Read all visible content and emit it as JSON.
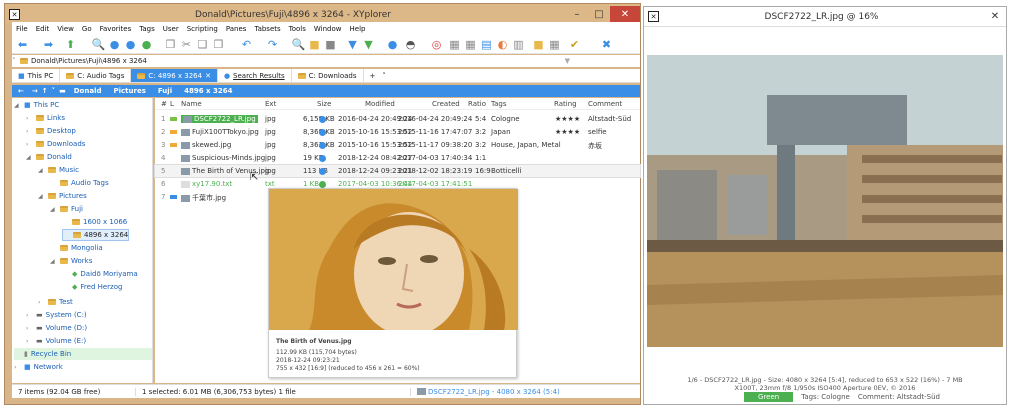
{
  "main": {
    "title": "Donald\\Pictures\\Fuji\\4896 x 3264 - XYplorer",
    "menu": [
      "File",
      "Edit",
      "View",
      "Go",
      "Favorites",
      "Tags",
      "User",
      "Scripting",
      "Panes",
      "Tabsets",
      "Tools",
      "Window",
      "Help"
    ],
    "address": "Donald\\Pictures\\Fuji\\4896 x 3264",
    "tabs": [
      {
        "label": "This PC"
      },
      {
        "label": "C: Audio Tags"
      },
      {
        "label": "C: 4896 x 3264"
      },
      {
        "label": "Search Results"
      },
      {
        "label": "C: Downloads"
      }
    ],
    "tab_add": "+",
    "breadcrumb": [
      "Donald",
      "Pictures",
      "Fuji",
      "4896 x 3264"
    ]
  },
  "tree": [
    {
      "label": "This PC",
      "level": 0
    },
    {
      "label": "Links",
      "level": 1
    },
    {
      "label": "Desktop",
      "level": 1
    },
    {
      "label": "Downloads",
      "level": 1
    },
    {
      "label": "Donald",
      "level": 1
    },
    {
      "label": "Music",
      "level": 2
    },
    {
      "label": "Audio Tags",
      "level": 3
    },
    {
      "label": "Pictures",
      "level": 2
    },
    {
      "label": "Fuji",
      "level": 3
    },
    {
      "label": "1600 x 1066",
      "level": 4
    },
    {
      "label": "4896 x 3264",
      "level": 4
    },
    {
      "label": "Mongolia",
      "level": 3
    },
    {
      "label": "Works",
      "level": 3
    },
    {
      "label": "Daidō Moriyama",
      "level": 4
    },
    {
      "label": "Fred Herzog",
      "level": 4
    },
    {
      "label": "Test",
      "level": 2
    },
    {
      "label": "System (C:)",
      "level": 1
    },
    {
      "label": "Volume (D:)",
      "level": 1
    },
    {
      "label": "Volume (E:)",
      "level": 1
    },
    {
      "label": "Recycle Bin",
      "level": 1
    },
    {
      "label": "Network",
      "level": 0
    }
  ],
  "columns": {
    "num": "#",
    "label": "L",
    "name": "Name",
    "ext": "Ext",
    "size": "Size",
    "modified": "Modified",
    "created": "Created",
    "ratio": "Ratio",
    "tags": "Tags",
    "rating": "Rating",
    "comment": "Comment"
  },
  "rows": [
    {
      "num": "1",
      "name": "DSCF2722_LR.jpg",
      "ext": "jpg",
      "size": "6,159 KB",
      "modified": "2016-04-24 20:49:24",
      "created": "2016-04-24 20:49:24",
      "ratio": "5:4",
      "tags": "Cologne",
      "rating": "★★★★",
      "comment": "Altstadt-Süd"
    },
    {
      "num": "2",
      "name": "FujiX100TTokyo.jpg",
      "ext": "jpg",
      "size": "8,369 KB",
      "modified": "2015-10-16 15:53:52",
      "created": "2015-11-16 17:47:07",
      "ratio": "3:2",
      "tags": "Japan",
      "rating": "★★★★",
      "comment": "selfie"
    },
    {
      "num": "3",
      "name": "skewed.jpg",
      "ext": "jpg",
      "size": "8,363 KB",
      "modified": "2015-10-16 15:53:52",
      "created": "2015-11-17 09:38:20",
      "ratio": "3:2",
      "tags": "House, Japan, Metal",
      "rating": "",
      "comment": "赤坂"
    },
    {
      "num": "4",
      "name": "Suspicious-Minds.jpg",
      "ext": "jpg",
      "size": "19 KB",
      "modified": "2018-12-24 08:42:27",
      "created": "2017-04-03 17:40:34",
      "ratio": "1:1",
      "tags": "",
      "rating": "",
      "comment": ""
    },
    {
      "num": "5",
      "name": "The Birth of Venus.jpg",
      "ext": "jpg",
      "size": "113 KB",
      "modified": "2018-12-24 09:23:21",
      "created": "2018-12-02 18:23:19",
      "ratio": "16:9",
      "tags": "Botticelli",
      "rating": "",
      "comment": ""
    },
    {
      "num": "6",
      "name": "xy17.90.txt",
      "ext": "txt",
      "size": "1 KB",
      "modified": "2017-04-03 10:36:44",
      "created": "2017-04-03 17:41:51",
      "ratio": "",
      "tags": "",
      "rating": "",
      "comment": ""
    },
    {
      "num": "7",
      "name": "千葉市.jpg",
      "ext": "jpg",
      "size": "",
      "modified": "",
      "created": "",
      "ratio": "",
      "tags": "",
      "rating": "",
      "comment": ""
    }
  ],
  "tooltip": {
    "name": "The Birth of Venus.jpg",
    "size": "112.99 KB (115,704 bytes)",
    "date": "2018-12-24 09:23:21",
    "dims": "755 x 432  [16:9]  (reduced to 456 x 261 = 60%)"
  },
  "status": {
    "items": "7 items (92.04 GB free)",
    "selected": "1 selected: 6.01 MB (6,306,753 bytes)  1 file",
    "file": "DSCF2722_LR.jpg - 4080 x 3264 (5:4)"
  },
  "viewer": {
    "title": "DSCF2722_LR.jpg @ 16%",
    "info1": "1/6 - DSCF2722_LR.jpg - Size: 4080 x 3264 [5:4], reduced to 653 x 522 (16%) - 7 MB",
    "info2": "X100T, 23mm  f/8  1/950s  ISO400  Aperture 0EV, © 2016",
    "label": "Green",
    "tags": "Tags: Cologne",
    "comment": "Comment: Altstadt-Süd"
  },
  "colors": {
    "accent": "#3a8ee6",
    "frame": "#d9b58a",
    "close": "#c7463a",
    "label_green": "#4caf50"
  }
}
